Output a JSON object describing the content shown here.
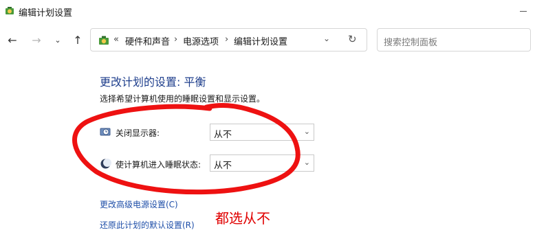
{
  "window": {
    "title": "编辑计划设置"
  },
  "nav": {
    "back_icon": "arrow-left-icon",
    "forward_icon": "arrow-right-icon",
    "history_icon": "chevron-down-icon",
    "up_icon": "arrow-up-icon"
  },
  "address": {
    "overflow": "«",
    "crumbs": [
      "硬件和声音",
      "电源选项",
      "编辑计划设置"
    ]
  },
  "search": {
    "placeholder": "搜索控制面板"
  },
  "main": {
    "heading": "更改计划的设置: 平衡",
    "subtitle": "选择希望计算机使用的睡眠设置和显示设置。",
    "settings": [
      {
        "label": "关闭显示器:",
        "value": "从不",
        "icon": "monitor-clock-icon"
      },
      {
        "label": "使计算机进入睡眠状态:",
        "value": "从不",
        "icon": "moon-sleep-icon"
      }
    ],
    "links": {
      "advanced": "更改高级电源设置(C)",
      "restore": "还原此计划的默认设置(R)"
    }
  },
  "annotation": {
    "text": "都选从不",
    "color": "#e00000"
  },
  "colors": {
    "heading": "#1e3e8c",
    "link": "#1e4ea8"
  }
}
